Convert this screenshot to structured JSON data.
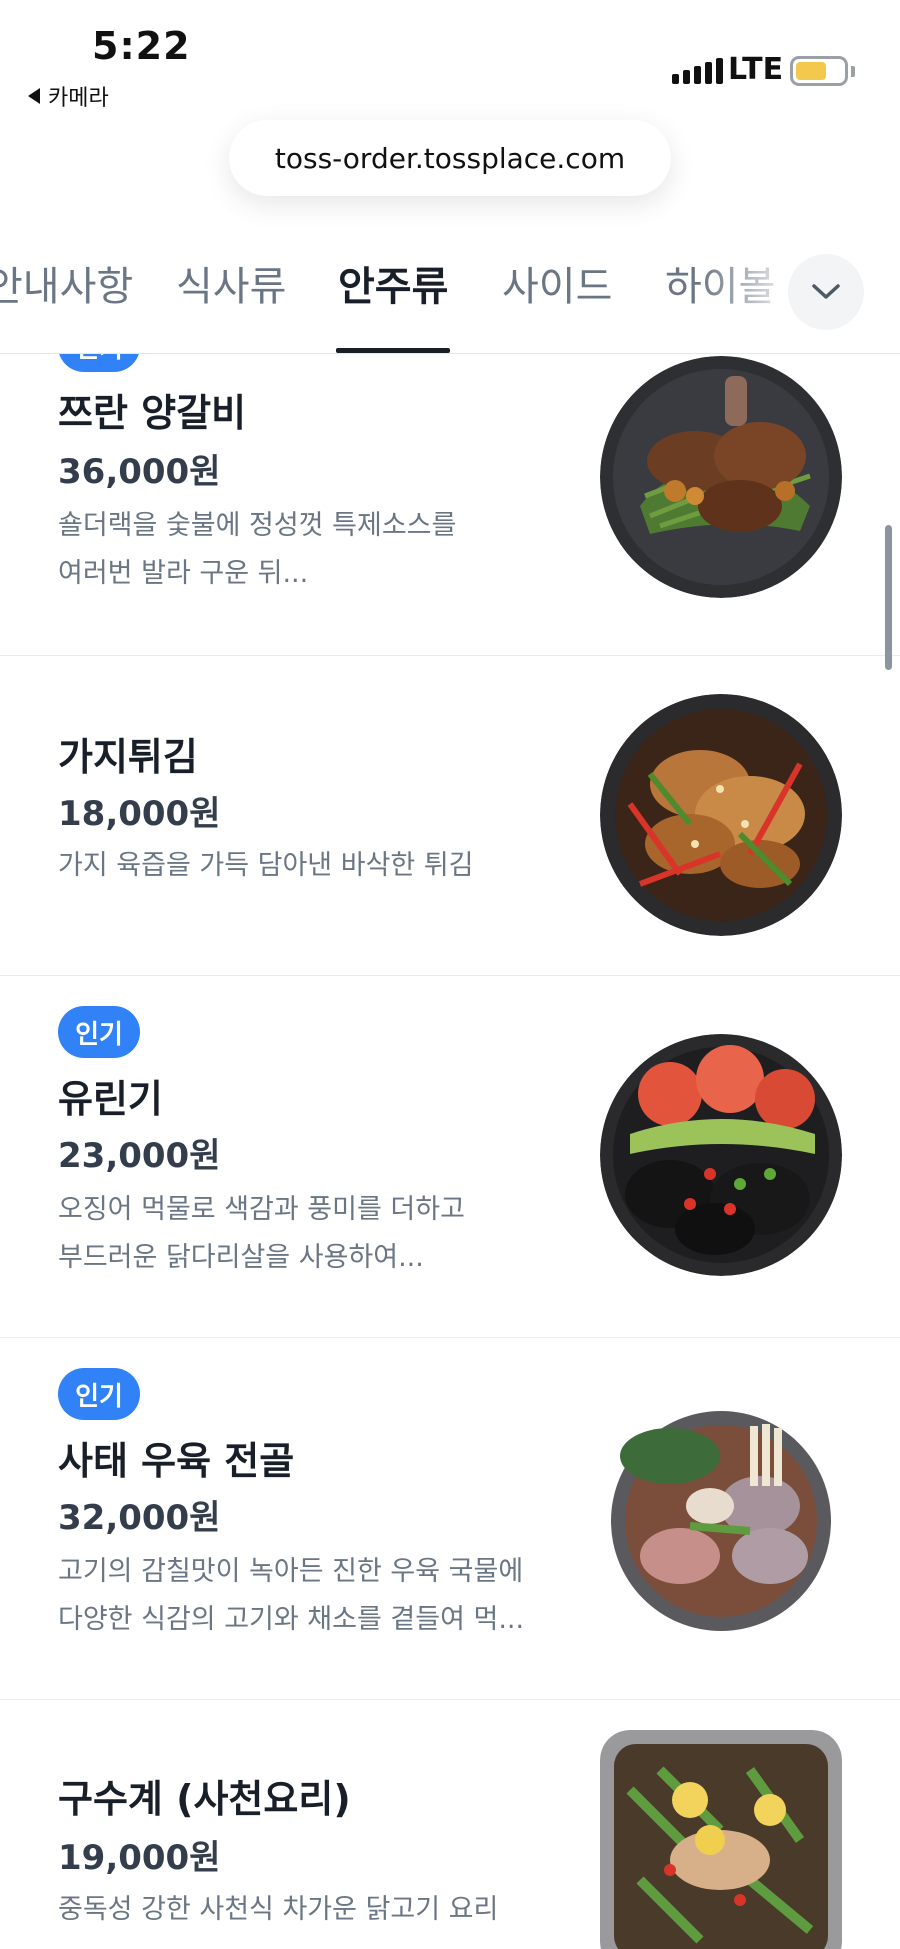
{
  "status_bar": {
    "time": "5:22",
    "back_app": "카메라",
    "network": "LTE",
    "battery_level": 0.66
  },
  "url_bar": {
    "url": "toss-order.tossplace.com"
  },
  "tabs": [
    {
      "label": "안내사항"
    },
    {
      "label": "식사류"
    },
    {
      "label": "안주류",
      "active": true
    },
    {
      "label": "사이드"
    },
    {
      "label": "하이볼"
    }
  ],
  "menu": [
    {
      "badge": "인기",
      "name": "쯔란 양갈비",
      "price": "36,000원",
      "desc_lines": [
        "숄더랙을 숯불에 정성껏 특제소스를",
        "여러번 발라 구운 뒤..."
      ]
    },
    {
      "name": "가지튀김",
      "price": "18,000원",
      "desc_lines": [
        "가지 육즙을 가득 담아낸 바삭한 튀김"
      ]
    },
    {
      "badge": "인기",
      "name": "유린기",
      "price": "23,000원",
      "desc_lines": [
        "오징어 먹물로 색감과 풍미를 더하고",
        "부드러운 닭다리살을 사용하여..."
      ]
    },
    {
      "badge": "인기",
      "name": "사태 우육 전골",
      "price": "32,000원",
      "desc_lines": [
        "고기의 감칠맛이 녹아든 진한 우육 국물에",
        "다양한 식감의 고기와 채소를 곁들여 먹..."
      ]
    },
    {
      "name": "구수계 (사천요리)",
      "price": "19,000원",
      "desc_lines": [
        "중독성 강한 사천식 차가운 닭고기 요리"
      ]
    }
  ],
  "colors": {
    "badge": "#3182f6",
    "active_tab": "#191f28",
    "inactive_tab": "#6b7684"
  }
}
